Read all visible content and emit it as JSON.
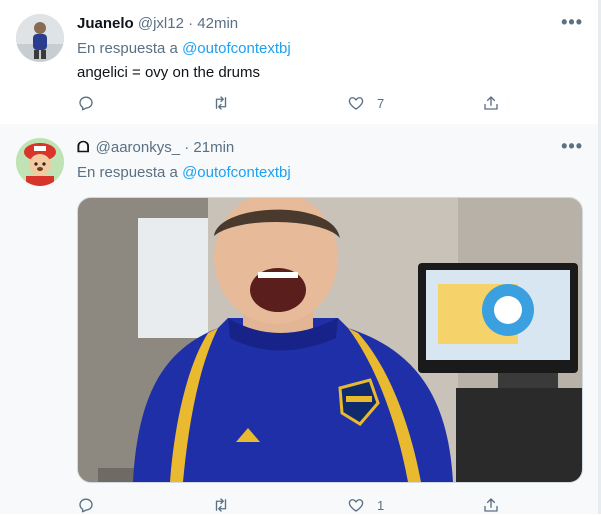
{
  "tweets": [
    {
      "name": "Juanelo",
      "handle": "@jxl12",
      "separator": "·",
      "time": "42min",
      "reply_prefix": "En respuesta a",
      "reply_to": "@outofcontextbj",
      "text": "angelici = ovy on the drums",
      "more_label": "•••",
      "counts": {
        "reply": "",
        "retweet": "",
        "like": "7",
        "share": ""
      }
    },
    {
      "name": "ᗝ",
      "handle": "@aaronkys_",
      "separator": "·",
      "time": "21min",
      "reply_prefix": "En respuesta a",
      "reply_to": "@outofcontextbj",
      "more_label": "•••",
      "counts": {
        "reply": "",
        "retweet": "",
        "like": "1",
        "share": ""
      }
    }
  ],
  "icons": {
    "reply": "reply-icon",
    "retweet": "retweet-icon",
    "like": "like-icon",
    "share": "share-icon",
    "more": "more-icon"
  },
  "colors": {
    "accent": "#1da1f2",
    "muted": "#5b7083",
    "text": "#0f1419",
    "highlight_bg": "#f7f9fa",
    "jacket": "#1f2fa8",
    "stripe": "#e9b92f"
  }
}
